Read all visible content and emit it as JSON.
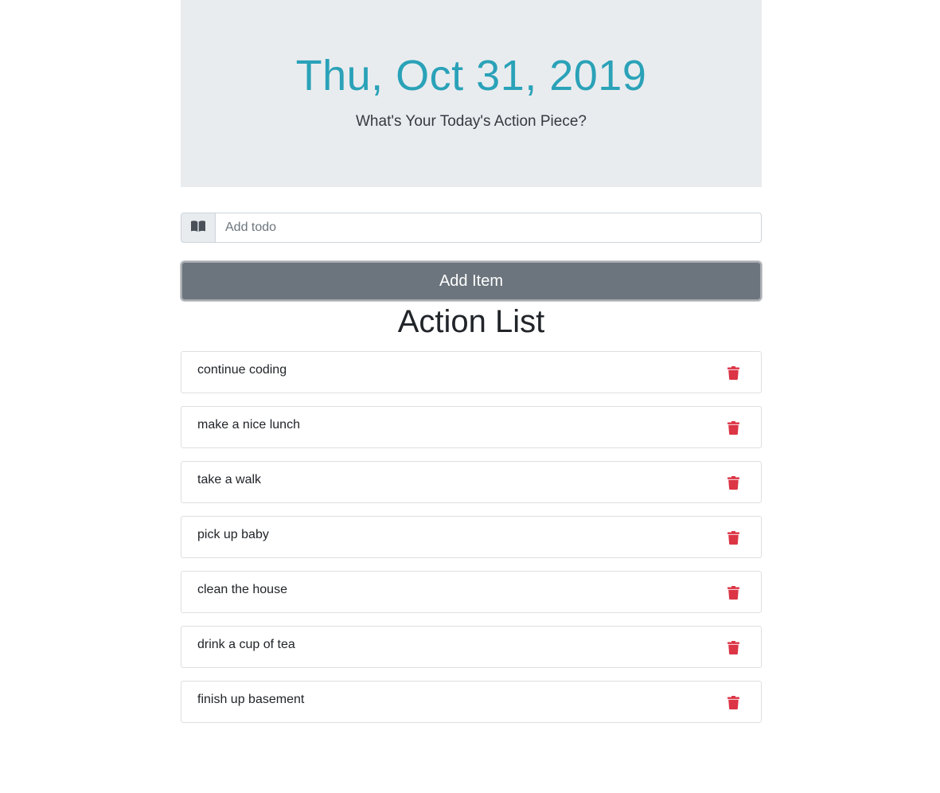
{
  "header": {
    "date": "Thu, Oct 31, 2019",
    "subtitle": "What's Your Today's Action Piece?"
  },
  "form": {
    "input_icon": "book-icon",
    "input_value": "",
    "input_placeholder": "Add todo",
    "add_button_label": "Add Item"
  },
  "list": {
    "title": "Action List",
    "delete_icon": "trash-icon",
    "items": [
      {
        "text": "continue coding"
      },
      {
        "text": "make a nice lunch"
      },
      {
        "text": "take a walk"
      },
      {
        "text": "pick up baby"
      },
      {
        "text": "clean the house"
      },
      {
        "text": "drink a cup of tea"
      },
      {
        "text": "finish up basement"
      }
    ]
  },
  "colors": {
    "accent": "#2aa2b8",
    "jumbotron_bg": "#e9ecef",
    "button_bg": "#6c757d",
    "delete": "#dc3545"
  }
}
